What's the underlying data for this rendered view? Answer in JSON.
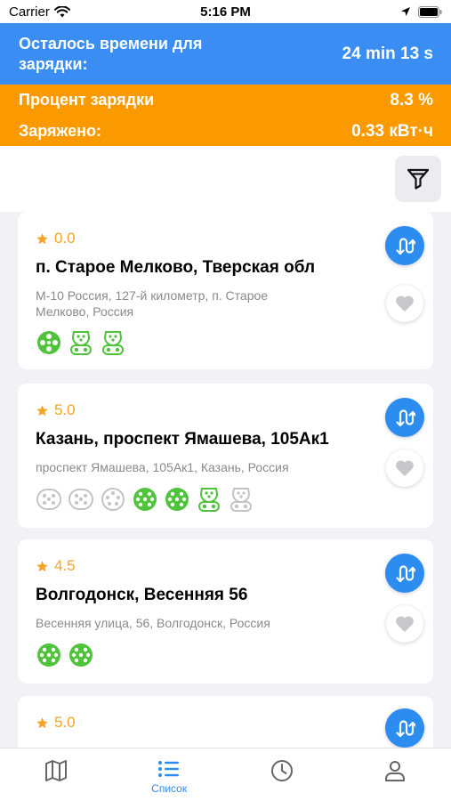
{
  "status_bar": {
    "carrier": "Carrier",
    "time": "5:16 PM"
  },
  "charging": {
    "time_label": "Осталось времени для зарядки:",
    "time_value": "24 min 13 s",
    "percent_label": "Процент зарядки",
    "percent_value": "8.3 %",
    "charged_label": "Заряжено:",
    "charged_value": "0.33 кВт·ч"
  },
  "stations": [
    {
      "rating": "0.0",
      "title": "п. Старое Мелково, Тверская обл",
      "address": "М-10 Россия, 127-й километр, п. Старое Мелково, Россия",
      "connectors": [
        {
          "type": "chademo",
          "status": "available"
        },
        {
          "type": "type2",
          "status": "available"
        },
        {
          "type": "type2",
          "status": "available"
        }
      ]
    },
    {
      "rating": "5.0",
      "title": "Казань, проспект Ямашева, 105Ак1",
      "address": "проспект Ямашева, 105Ак1, Казань, Россия",
      "connectors": [
        {
          "type": "type1",
          "status": "unavailable"
        },
        {
          "type": "type1",
          "status": "unavailable"
        },
        {
          "type": "gbt",
          "status": "unavailable"
        },
        {
          "type": "ccs",
          "status": "available"
        },
        {
          "type": "ccs",
          "status": "available"
        },
        {
          "type": "type2",
          "status": "available"
        },
        {
          "type": "type2",
          "status": "unavailable"
        }
      ]
    },
    {
      "rating": "4.5",
      "title": "Волгодонск, Весенняя 56",
      "address": "Весенняя улица, 56, Волгодонск, Россия",
      "connectors": [
        {
          "type": "ccs",
          "status": "available"
        },
        {
          "type": "ccs",
          "status": "available"
        }
      ]
    },
    {
      "rating": "5.0",
      "title": "",
      "address": "",
      "connectors": []
    }
  ],
  "tabs": [
    {
      "icon": "map-icon",
      "label": "",
      "active": false
    },
    {
      "icon": "list-icon",
      "label": "Список",
      "active": true
    },
    {
      "icon": "clock-icon",
      "label": "",
      "active": false
    },
    {
      "icon": "profile-icon",
      "label": "",
      "active": false
    }
  ],
  "colors": {
    "primary_blue": "#3a8ef3",
    "accent_orange": "#fb9a00",
    "star": "#f0a428",
    "connector_available": "#4fc43b",
    "connector_unavailable": "#c4c4c8"
  }
}
